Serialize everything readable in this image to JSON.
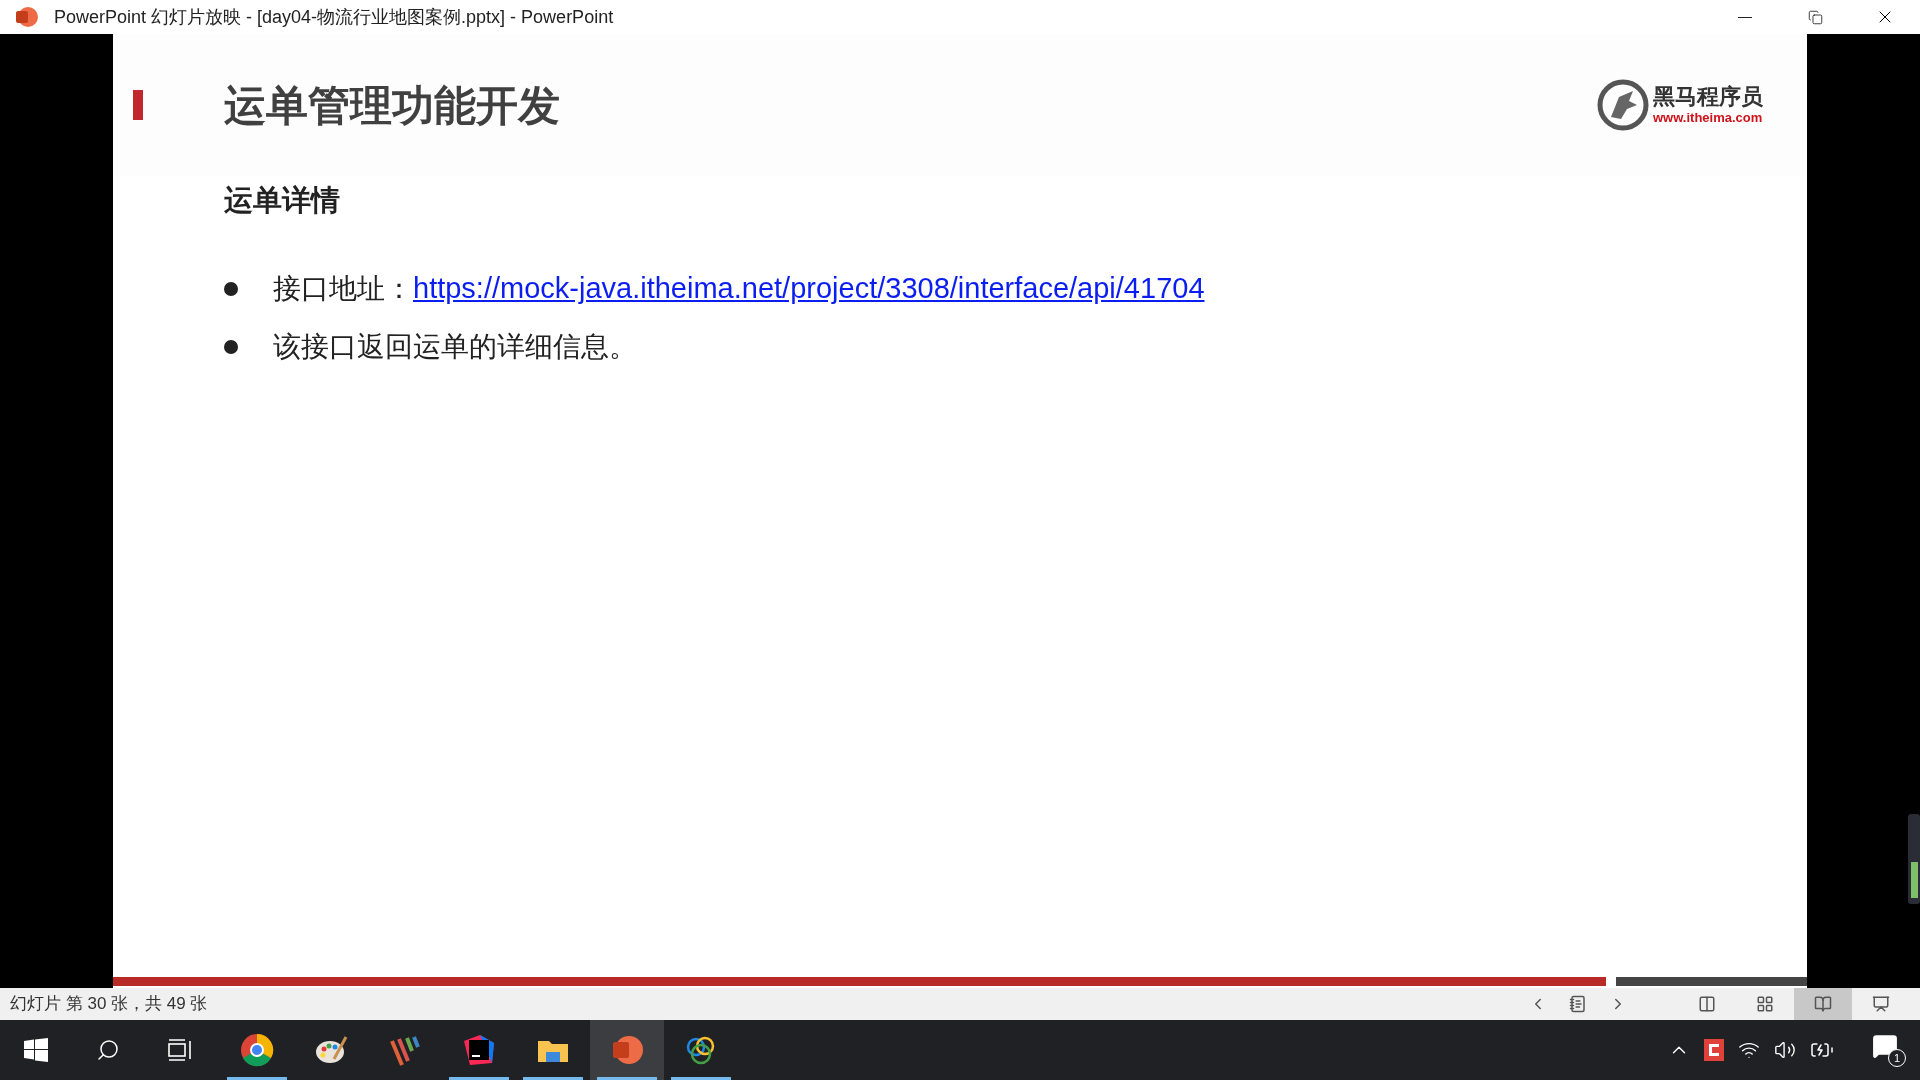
{
  "window": {
    "title": "PowerPoint 幻灯片放映 - [day04-物流行业地图案例.pptx] - PowerPoint"
  },
  "slide": {
    "title": "运单管理功能开发",
    "logo": {
      "name": "黑马程序员",
      "url": "www.itheima.com"
    },
    "subtitle": "运单详情",
    "bullets": [
      {
        "kind": "link",
        "label": "接口地址：",
        "link": "https://mock-java.itheima.net/project/3308/interface/api/41704"
      },
      {
        "kind": "text",
        "text": "该接口返回运单的详细信息。"
      }
    ]
  },
  "progress": {
    "level": 0.887
  },
  "status_bar": {
    "slide_info": "幻灯片 第 30 张，共 49 张",
    "views": [
      {
        "kind": "normal",
        "selected": false
      },
      {
        "kind": "sorter",
        "selected": false
      },
      {
        "kind": "reading",
        "selected": true
      },
      {
        "kind": "slideshow",
        "selected": false
      }
    ]
  },
  "taskbar": {
    "apps": [
      {
        "kind": "chrome",
        "running": true,
        "selected": false
      },
      {
        "kind": "paint",
        "running": false,
        "selected": false
      },
      {
        "kind": "stripes",
        "running": false,
        "selected": false
      },
      {
        "kind": "ide",
        "running": true,
        "selected": false
      },
      {
        "kind": "folder",
        "running": true,
        "selected": false
      },
      {
        "kind": "powerpoint",
        "running": true,
        "selected": true
      },
      {
        "kind": "rings",
        "running": true,
        "selected": false
      }
    ],
    "notification_count": "1"
  }
}
